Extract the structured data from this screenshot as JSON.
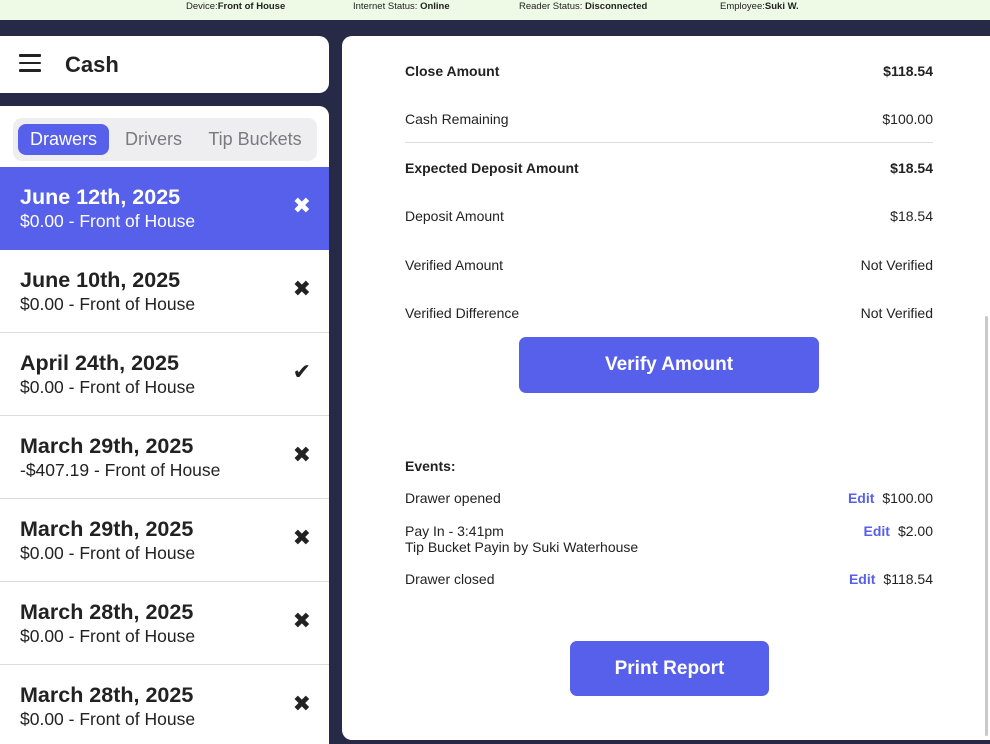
{
  "status_bar": {
    "device_label": "Device:",
    "device_value": "Front of House",
    "internet_label": "Internet Status: ",
    "internet_value": "Online",
    "reader_label": "Reader Status: ",
    "reader_value": "Disconnected",
    "employee_label": "Employee:",
    "employee_value": "Suki W."
  },
  "header": {
    "title": "Cash"
  },
  "tabs": [
    {
      "label": "Drawers",
      "active": true
    },
    {
      "label": "Drivers",
      "active": false
    },
    {
      "label": "Tip Buckets",
      "active": false
    }
  ],
  "drawers": [
    {
      "date": "June 12th, 2025",
      "subtitle": "$0.00 - Front of House",
      "mark": "✖",
      "selected": true
    },
    {
      "date": "June 10th, 2025",
      "subtitle": "$0.00 - Front of House",
      "mark": "✖",
      "selected": false
    },
    {
      "date": "April 24th, 2025",
      "subtitle": "$0.00 - Front of House",
      "mark": "✔",
      "selected": false
    },
    {
      "date": "March 29th, 2025",
      "subtitle": "-$407.19 - Front of House",
      "mark": "✖",
      "selected": false
    },
    {
      "date": "March 29th, 2025",
      "subtitle": "$0.00 - Front of House",
      "mark": "✖",
      "selected": false
    },
    {
      "date": "March 28th, 2025",
      "subtitle": "$0.00 - Front of House",
      "mark": "✖",
      "selected": false
    },
    {
      "date": "March 28th, 2025",
      "subtitle": "$0.00 - Front of House",
      "mark": "✖",
      "selected": false
    }
  ],
  "detail": {
    "close_amount": {
      "label": "Close Amount",
      "value": "$118.54"
    },
    "cash_remaining": {
      "label": "Cash Remaining",
      "value": "$100.00"
    },
    "expected_deposit": {
      "label": "Expected Deposit Amount",
      "value": "$18.54"
    },
    "deposit_amount": {
      "label": "Deposit Amount",
      "value": "$18.54"
    },
    "verified_amount": {
      "label": "Verified Amount",
      "value": "Not Verified"
    },
    "verified_difference": {
      "label": "Verified Difference",
      "value": "Not Verified"
    },
    "verify_button": "Verify Amount",
    "events_title": "Events:",
    "events": [
      {
        "line1": "Drawer opened",
        "line2": "",
        "edit": "Edit",
        "amount": "$100.00"
      },
      {
        "line1": "Pay In - 3:41pm",
        "line2": "Tip Bucket Payin by Suki Waterhouse",
        "edit": "Edit",
        "amount": "$2.00"
      },
      {
        "line1": "Drawer closed",
        "line2": "",
        "edit": "Edit",
        "amount": "$118.54"
      }
    ],
    "print_button": "Print Report"
  },
  "colors": {
    "accent": "#5660ea",
    "background": "#272a47",
    "status_bar": "#eef9e6"
  }
}
